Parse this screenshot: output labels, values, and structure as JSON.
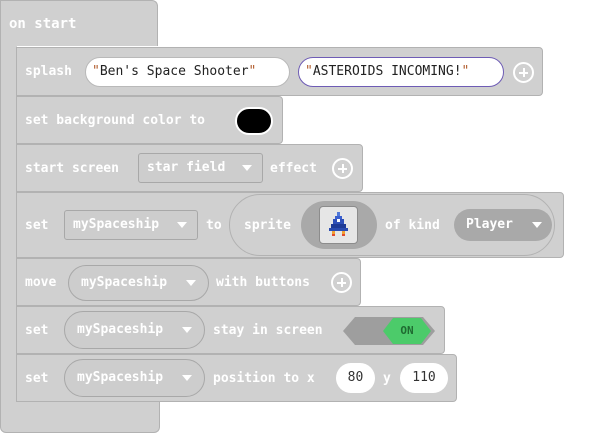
{
  "event": {
    "label": "on start"
  },
  "splash": {
    "label": "splash",
    "title": "Ben's Space Shooter",
    "subtitle": "ASTEROIDS INCOMING!"
  },
  "background": {
    "label": "set background color to",
    "color": "#000000"
  },
  "start_screen": {
    "label": "start screen",
    "effect_value": "star field",
    "effect_label": "effect"
  },
  "set_sprite": {
    "label": "set",
    "variable": "mySpaceship",
    "to_label": "to",
    "sprite_label": "sprite",
    "sprite_icon": "spaceship-icon",
    "of_kind_label": "of kind",
    "kind": "Player"
  },
  "move": {
    "label": "move",
    "variable": "mySpaceship",
    "with_label": "with buttons"
  },
  "stay": {
    "label": "set",
    "variable": "mySpaceship",
    "stay_label": "stay in screen",
    "toggle_value": "ON"
  },
  "position": {
    "label": "set",
    "variable": "mySpaceship",
    "pos_label": "position to x",
    "x": "80",
    "y_label": "y",
    "y": "110"
  },
  "colors": {
    "block": "#d0d0d0",
    "toggle_on": "#4ccb6a",
    "swatch": "#000000"
  }
}
